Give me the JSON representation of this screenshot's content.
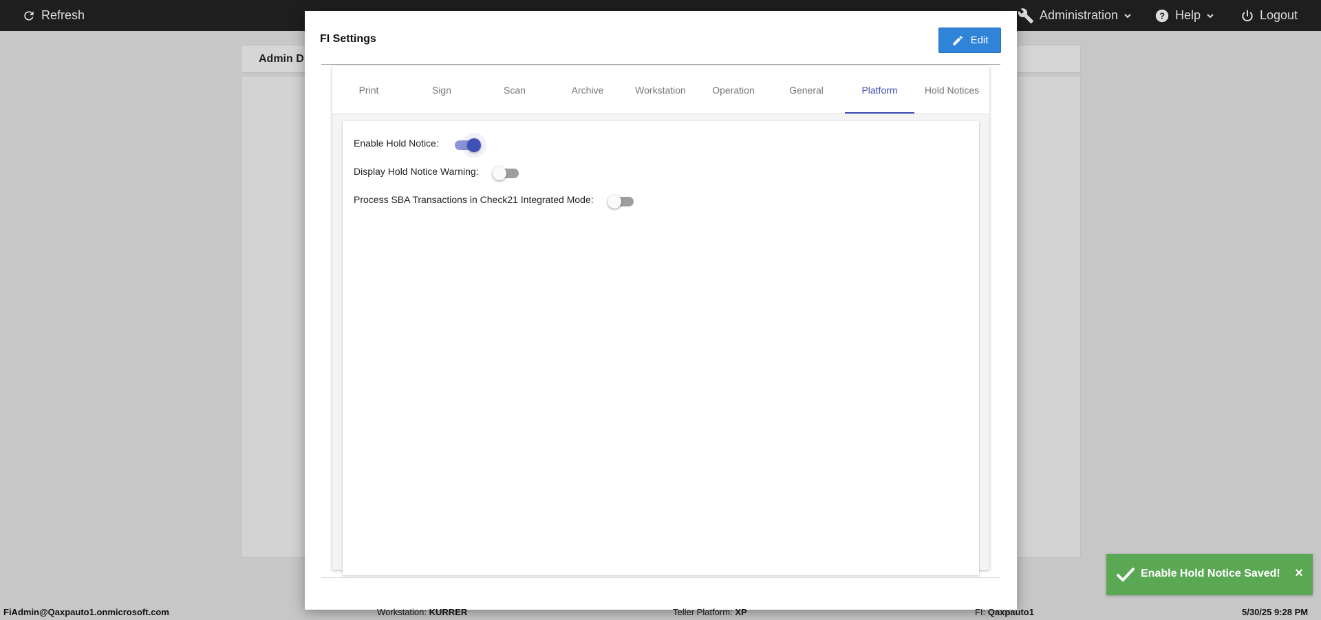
{
  "topbar": {
    "refresh_label": "Refresh",
    "administration_label": "Administration",
    "help_label": "Help",
    "logout_label": "Logout"
  },
  "background": {
    "card_title": "Admin D"
  },
  "modal": {
    "title": "FI Settings",
    "edit_label": "Edit",
    "tabs": [
      {
        "label": "Print"
      },
      {
        "label": "Sign"
      },
      {
        "label": "Scan"
      },
      {
        "label": "Archive"
      },
      {
        "label": "Workstation"
      },
      {
        "label": "Operation"
      },
      {
        "label": "General"
      },
      {
        "label": "Platform"
      },
      {
        "label": "Hold Notices"
      }
    ],
    "active_tab": "Platform",
    "settings": [
      {
        "label": "Enable Hold Notice:",
        "enabled": true
      },
      {
        "label": "Display Hold Notice Warning:",
        "enabled": false
      },
      {
        "label": "Process SBA Transactions in Check21 Integrated Mode:",
        "enabled": false
      }
    ]
  },
  "statusbar": {
    "user": "FiAdmin@Qaxpauto1.onmicrosoft.com",
    "workstation_label": "Workstation:",
    "workstation_value": "KURRER",
    "teller_label": "Teller Platform:",
    "teller_value": "XP",
    "fi_label": "FI:",
    "fi_value": "Qaxpauto1",
    "datetime": "5/30/25 9:28 PM"
  },
  "toast": {
    "message": "Enable Hold Notice Saved!",
    "close_glyph": "×"
  },
  "colors": {
    "accent": "#3f51b5",
    "edit_button": "#2f84d8",
    "toast_success": "#5aa854",
    "topbar": "#1e1e1e"
  }
}
